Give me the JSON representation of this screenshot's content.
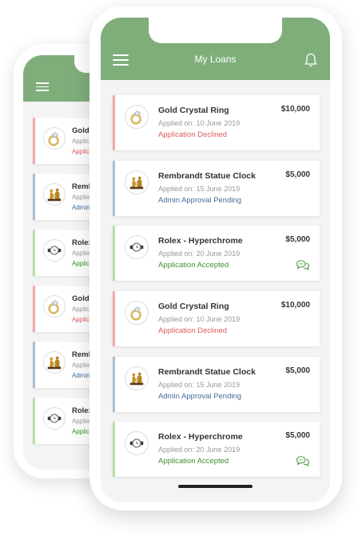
{
  "colors": {
    "header": "#7fae7b",
    "declined": "#e05a5a",
    "pending": "#3f6f99",
    "accepted": "#3f8f2e"
  },
  "header": {
    "title": "My Loans",
    "menu_icon": "hamburger-menu-icon",
    "bell_icon": "bell-icon"
  },
  "loans": [
    {
      "name": "Gold Crystal Ring",
      "date": "Applied on: 10 June 2019",
      "amount": "$10,000",
      "status": "Application Declined",
      "state": "declined",
      "image": "ring"
    },
    {
      "name": "Rembrandt Statue Clock",
      "date": "Applied on: 15 June 2019",
      "amount": "$5,000",
      "status": "Admin Approval Pending",
      "state": "pending",
      "image": "clock"
    },
    {
      "name": "Rolex - Hyperchrome",
      "date": "Applied on: 20 June 2019",
      "amount": "$5,000",
      "status": "Application Accepted",
      "state": "accepted",
      "image": "watch",
      "chat": true
    },
    {
      "name": "Gold Crystal Ring",
      "date": "Applied on: 10 June 2019",
      "amount": "$10,000",
      "status": "Application Declined",
      "state": "declined",
      "image": "ring"
    },
    {
      "name": "Rembrandt Statue Clock",
      "date": "Applied on: 15 June 2019",
      "amount": "$5,000",
      "status": "Admin Approval Pending",
      "state": "pending",
      "image": "clock"
    },
    {
      "name": "Rolex - Hyperchrome",
      "date": "Applied on: 20 June 2019",
      "amount": "$5,000",
      "status": "Application Accepted",
      "state": "accepted",
      "image": "watch",
      "chat": true
    }
  ],
  "back_cards": [
    {
      "name": "Gold",
      "date": "Applic",
      "status": "Applic",
      "state": "declined",
      "image": "ring"
    },
    {
      "name": "Rembr",
      "date": "Applie",
      "status": "Admin",
      "state": "pending",
      "image": "clock"
    },
    {
      "name": "Rolex",
      "date": "Applie",
      "status": "Applic",
      "state": "accepted",
      "image": "watch"
    },
    {
      "name": "Gold",
      "date": "Applic",
      "status": "Applic",
      "state": "declined",
      "image": "ring"
    },
    {
      "name": "Rembr",
      "date": "Applie",
      "status": "Admin",
      "state": "pending",
      "image": "clock"
    },
    {
      "name": "Rolex",
      "date": "Applie",
      "status": "Applic",
      "state": "accepted",
      "image": "watch"
    }
  ]
}
